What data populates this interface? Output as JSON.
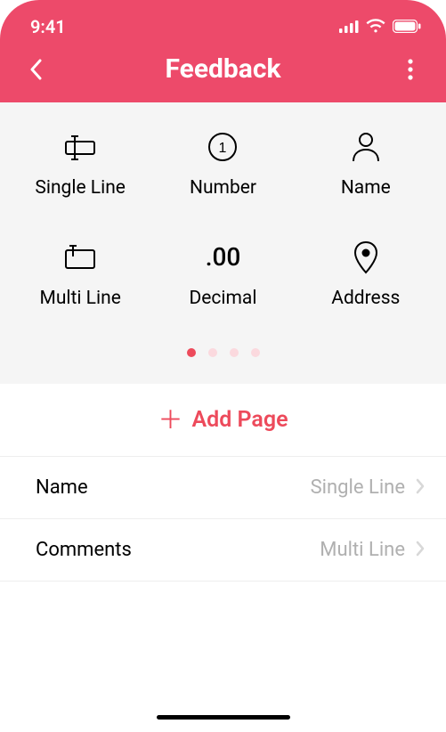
{
  "status": {
    "time": "9:41"
  },
  "header": {
    "title": "Feedback"
  },
  "palette": {
    "items": [
      {
        "label": "Single Line"
      },
      {
        "label": "Number"
      },
      {
        "label": "Name"
      },
      {
        "label": "Multi Line"
      },
      {
        "label": "Decimal"
      },
      {
        "label": "Address"
      }
    ],
    "decimal_glyph": ".00"
  },
  "actions": {
    "add_page": "Add Page"
  },
  "fields": [
    {
      "name": "Name",
      "type": "Single Line"
    },
    {
      "name": "Comments",
      "type": "Multi Line"
    }
  ]
}
